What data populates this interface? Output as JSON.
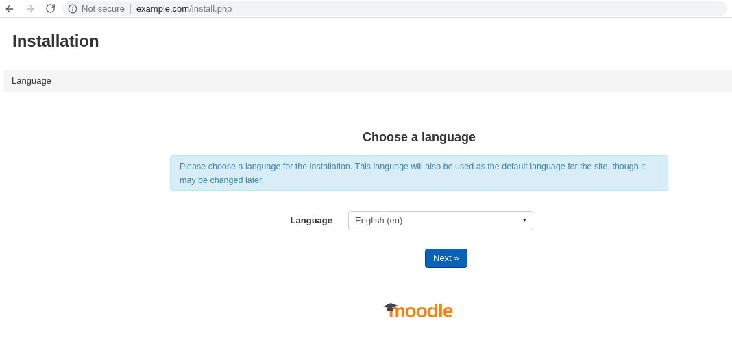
{
  "browser": {
    "security": "Not secure",
    "url_host": "example.com",
    "url_path": "/install.php"
  },
  "page_title": "Installation",
  "breadcrumb": "Language",
  "heading": "Choose a language",
  "alert": "Please choose a language for the installation. This language will also be used as the default language for the site, though it may be changed later.",
  "form": {
    "label": "Language",
    "value": "English (en)",
    "arrow": "▾"
  },
  "next_button": "Next »",
  "logo": "moodle"
}
